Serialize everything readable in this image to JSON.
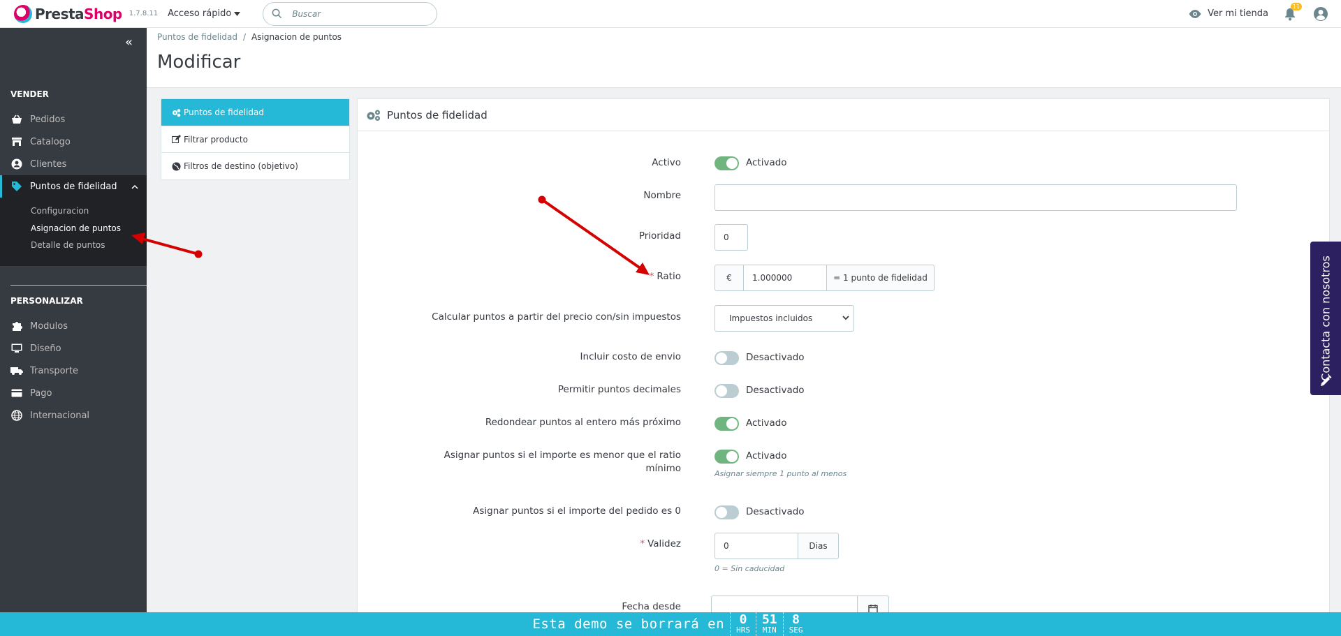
{
  "header": {
    "logo_presta": "Presta",
    "logo_shop": "Shop",
    "version": "1.7.8.11",
    "quick_access": "Acceso rápido",
    "search_placeholder": "Buscar",
    "view_store": "Ver mi tienda",
    "notifications_count": "11"
  },
  "sidebar": {
    "sections": [
      {
        "title": "VENDER"
      },
      {
        "title": "PERSONALIZAR"
      }
    ],
    "items": [
      {
        "label": "Pedidos",
        "icon": "basket-icon"
      },
      {
        "label": "Catalogo",
        "icon": "store-icon"
      },
      {
        "label": "Clientes",
        "icon": "user-circle-icon"
      },
      {
        "label": "Puntos de fidelidad",
        "icon": "tag-icon"
      },
      {
        "label": "Modulos",
        "icon": "puzzle-icon"
      },
      {
        "label": "Diseño",
        "icon": "monitor-icon"
      },
      {
        "label": "Transporte",
        "icon": "truck-icon"
      },
      {
        "label": "Pago",
        "icon": "card-icon"
      },
      {
        "label": "Internacional",
        "icon": "globe-icon"
      }
    ],
    "submenu": [
      "Configuracion",
      "Asignacion de puntos",
      "Detalle de puntos"
    ]
  },
  "breadcrumb": {
    "parent": "Puntos de fidelidad",
    "current": "Asignacion de puntos"
  },
  "page_title": "Modificar",
  "tabs": [
    "Puntos de fidelidad",
    "Filtrar producto",
    "Filtros de destino (objetivo)"
  ],
  "panel": {
    "title": "Puntos de fidelidad",
    "fields": {
      "activo": {
        "label": "Activo",
        "state": "Activado"
      },
      "nombre": {
        "label": "Nombre",
        "value": ""
      },
      "prioridad": {
        "label": "Prioridad",
        "value": "0"
      },
      "ratio": {
        "label": "Ratio",
        "currency": "€",
        "value": "1.000000",
        "suffix": "= 1 punto de fidelidad"
      },
      "calcular": {
        "label": "Calcular puntos a partir del precio con/sin impuestos",
        "selected": "Impuestos incluidos"
      },
      "envio": {
        "label": "Incluir costo de envio",
        "state": "Desactivado"
      },
      "decimales": {
        "label": "Permitir puntos decimales",
        "state": "Desactivado"
      },
      "redondear": {
        "label": "Redondear puntos al entero más próximo",
        "state": "Activado"
      },
      "menor_line1": "Asignar puntos si el importe es menor que el ratio",
      "menor_line2": "mínimo",
      "menor_state": "Activado",
      "menor_help": "Asignar siempre 1 punto al menos",
      "cero": {
        "label": "Asignar puntos si el importe del pedido es 0",
        "state": "Desactivado"
      },
      "validez": {
        "label": "Validez",
        "value": "0",
        "suffix": "Dias",
        "help": "0 = Sin caducidad"
      },
      "fecha_desde": {
        "label": "Fecha desde"
      }
    }
  },
  "contact_tab": "Contacta con nosotros",
  "demo_bar": {
    "text": "Esta demo se borrará en",
    "hours": "0",
    "hours_label": "HRS",
    "minutes": "51",
    "minutes_label": "MIN",
    "seconds": "8",
    "seconds_label": "SEG"
  },
  "colors": {
    "accent": "#25b9d7",
    "sidebar": "#363a41",
    "switch_on": "#70b580",
    "arrow": "#d50000"
  }
}
